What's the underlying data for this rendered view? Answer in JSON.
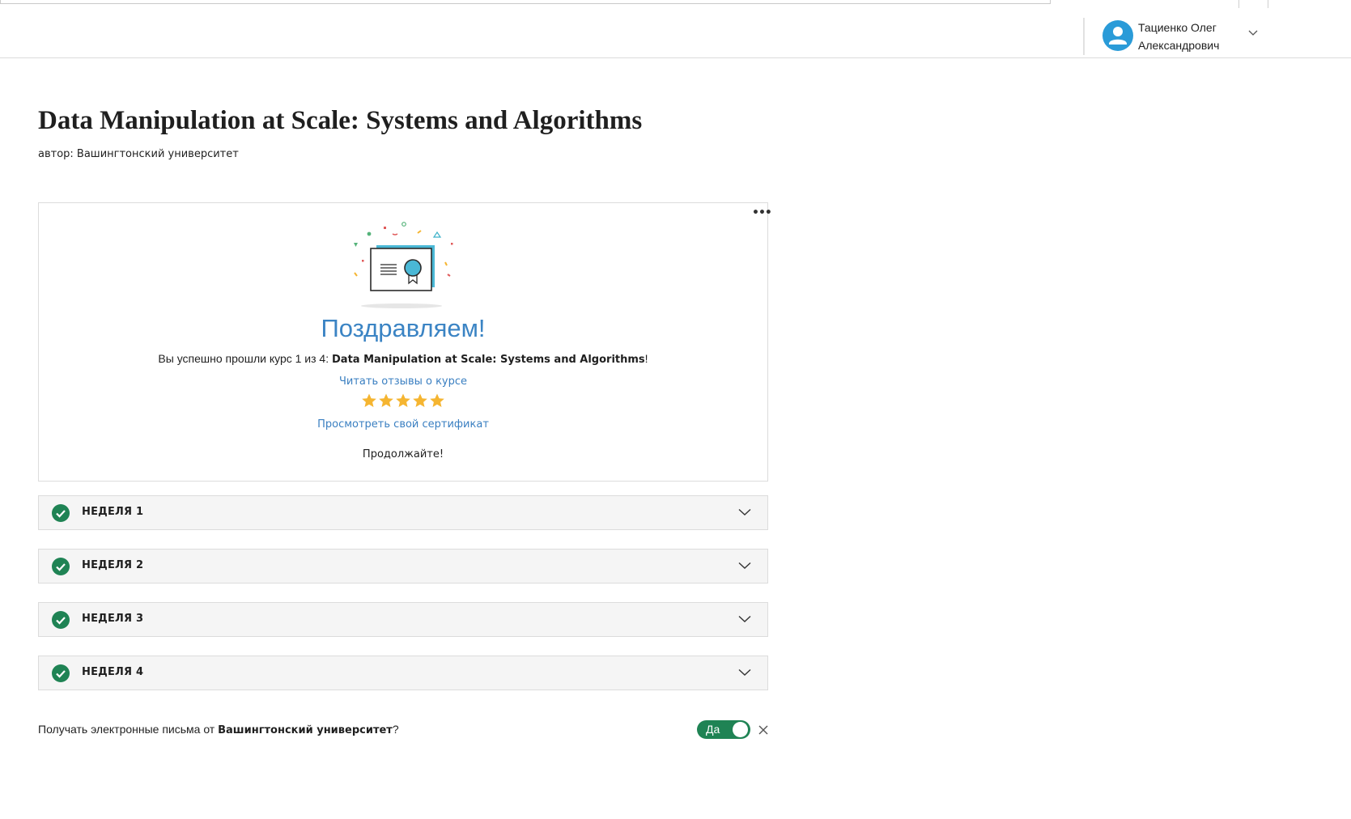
{
  "header": {
    "user_name": "Тациенко Олег Александрович"
  },
  "course": {
    "title": "Data Manipulation at Scale: Systems and Algorithms",
    "author": "автор: Вашингтонский университет"
  },
  "card": {
    "more_label": "•••",
    "congrats": "Поздравляем!",
    "completion_prefix": "Вы успешно прошли курс 1 из 4: ",
    "completion_course": "Data Manipulation at Scale: Systems and Algorithms",
    "completion_suffix": "!",
    "reviews_link": "Читать отзывы о курсе",
    "rating": {
      "value": 5,
      "max": 5
    },
    "certificate_link": "Просмотреть свой сертификат",
    "keep_going": "Продолжайте!"
  },
  "weeks": [
    {
      "label": "НЕДЕЛЯ 1",
      "completed": true
    },
    {
      "label": "НЕДЕЛЯ 2",
      "completed": true
    },
    {
      "label": "НЕДЕЛЯ 3",
      "completed": true
    },
    {
      "label": "НЕДЕЛЯ 4",
      "completed": true
    }
  ],
  "email_pref": {
    "prefix": "Получать электронные письма от ",
    "org": "Вашингтонский университет",
    "suffix": "?",
    "toggle_label": "Да",
    "enabled": true
  },
  "colors": {
    "accent_blue": "#3b84c4",
    "link_blue": "#3a7fc1",
    "success_green": "#1f8354",
    "star_gold": "#f5b531",
    "avatar_blue": "#2a9bd8"
  },
  "icons": {
    "avatar": "person-icon",
    "user_menu": "chevron-down-icon",
    "week_status": "check-circle-icon",
    "week_expand": "chevron-down-icon",
    "close": "close-icon",
    "star": "star-icon",
    "illustration": "certificate-icon"
  }
}
